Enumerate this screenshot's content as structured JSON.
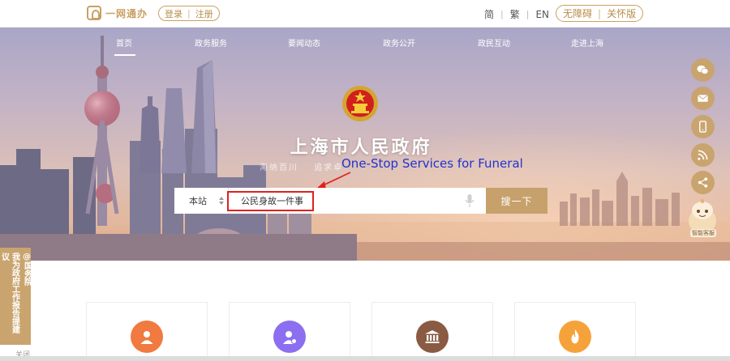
{
  "header": {
    "logo_text": "一网通办",
    "login": "登录",
    "register": "注册",
    "lang_simplified": "简",
    "lang_traditional": "繁",
    "lang_en": "EN",
    "accessibility": "无障碍",
    "elder_mode": "关怀版"
  },
  "nav": {
    "items": [
      "首页",
      "政务服务",
      "要闻动态",
      "政务公开",
      "政民互动",
      "走进上海"
    ],
    "active": "首页"
  },
  "hero": {
    "title": "上海市人民政府",
    "slogan_left": "海纳百川",
    "slogan_right": "追求卓"
  },
  "annotation": {
    "text": "One-Stop Services for Funeral",
    "color": "#2233cc",
    "highlight_color": "#e0201f"
  },
  "search": {
    "scope": "本站",
    "value": "公民身故一件事",
    "button": "搜一下"
  },
  "side_tools": [
    "wechat-icon",
    "mail-icon",
    "mobile-icon",
    "rss-icon",
    "share-icon"
  ],
  "robot_label": "智能客服",
  "feedback": {
    "col1": "我为政府工作报告提建议",
    "col2": "@国务院",
    "close": "关闭"
  },
  "cards": [
    {
      "name": "card-user",
      "color": "#f07a3f"
    },
    {
      "name": "card-service",
      "color": "#8c6ff0"
    },
    {
      "name": "card-government",
      "color": "#8a5a43"
    },
    {
      "name": "card-fire",
      "color": "#f6a23a"
    }
  ],
  "colors": {
    "accent": "#c9a46e",
    "brand_gold": "#c9a063"
  }
}
